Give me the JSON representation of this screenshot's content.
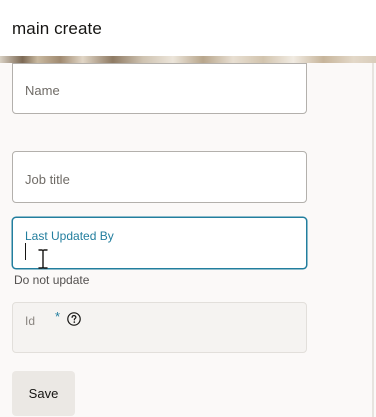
{
  "header": {
    "title": "main create"
  },
  "form": {
    "name_field": {
      "label": "Name",
      "value": ""
    },
    "job_title_field": {
      "label": "Job title",
      "value": ""
    },
    "last_updated_by_field": {
      "label": "Last Updated By",
      "value": "",
      "help_text": "Do not update",
      "focused": true
    },
    "id_field": {
      "label": "Id",
      "required_marker": "*",
      "readonly": true,
      "help_icon": "question-circle-icon"
    },
    "save_label": "Save"
  },
  "colors": {
    "accent": "#227e9e",
    "header_bg": "#ffffff",
    "page_bg": "#fbf9f8",
    "button_bg": "#ebe8e4"
  }
}
